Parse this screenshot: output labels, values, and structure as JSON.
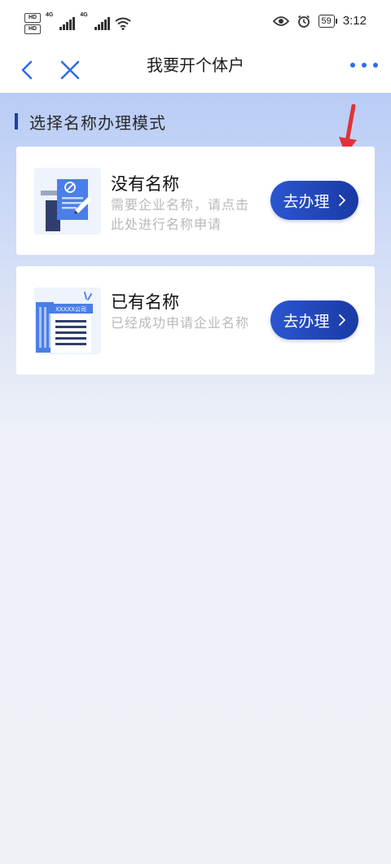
{
  "statusbar": {
    "hd1": "HD",
    "hd2": "HD",
    "net1": "4G",
    "net2": "4G",
    "battery": "59",
    "time": "3:12"
  },
  "navbar": {
    "title": "我要开个体户",
    "accent": "#2d6ee6"
  },
  "section": {
    "title": "选择名称办理模式"
  },
  "cards": [
    {
      "title": "没有名称",
      "desc": "需要企业名称，请点击此处进行名称申请",
      "button": "去办理"
    },
    {
      "title": "已有名称",
      "desc": "已经成功申请企业名称",
      "button": "去办理"
    }
  ],
  "icons": {
    "company_sign": "XXXXX公司"
  },
  "colors": {
    "button_start": "#2b56d0",
    "button_end": "#1a3aa5",
    "annotation_arrow": "#e0323a"
  }
}
